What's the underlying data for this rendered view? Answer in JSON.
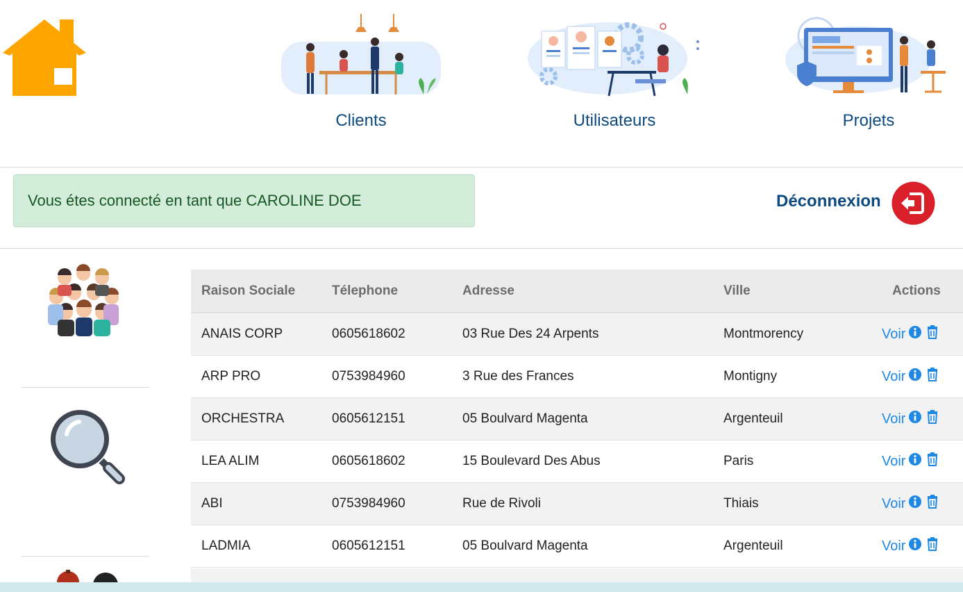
{
  "nav": {
    "clients_label": "Clients",
    "users_label": "Utilisateurs",
    "projects_label": "Projets"
  },
  "session": {
    "message": "Vous étes connecté en tant que CAROLINE DOE",
    "logout_label": "Déconnexion"
  },
  "table": {
    "headers": [
      "Raison Sociale",
      "Télephone",
      "Adresse",
      "Ville",
      "Actions"
    ],
    "rows": [
      {
        "raison": "ANAIS CORP",
        "tel": "0605618602",
        "adresse": "03 Rue Des 24 Arpents",
        "ville": "Montmorency",
        "action": "Voir"
      },
      {
        "raison": "ARP PRO",
        "tel": "0753984960",
        "adresse": "3 Rue des Frances",
        "ville": "Montigny",
        "action": "Voir"
      },
      {
        "raison": "ORCHESTRA",
        "tel": "0605612151",
        "adresse": "05 Boulvard Magenta",
        "ville": "Argenteuil",
        "action": "Voir"
      },
      {
        "raison": "LEA ALIM",
        "tel": "0605618602",
        "adresse": "15 Boulevard Des Abus",
        "ville": "Paris",
        "action": "Voir"
      },
      {
        "raison": "ABI",
        "tel": "0753984960",
        "adresse": "Rue de Rivoli",
        "ville": "Thiais",
        "action": "Voir"
      },
      {
        "raison": "LADMIA",
        "tel": "0605612151",
        "adresse": "05 Boulvard Magenta",
        "ville": "Argenteuil",
        "action": "Voir"
      }
    ]
  },
  "colors": {
    "brand_blue": "#0d4a80",
    "link_blue": "#1e88e5",
    "home_orange": "#ffa500",
    "logout_red": "#d9202a",
    "alert_green_bg": "#d4edda"
  },
  "icons": {
    "home": "home-icon",
    "logout": "logout-icon",
    "group": "people-group-icon",
    "search": "magnifier-icon",
    "info": "info-icon",
    "trash": "trash-icon"
  }
}
